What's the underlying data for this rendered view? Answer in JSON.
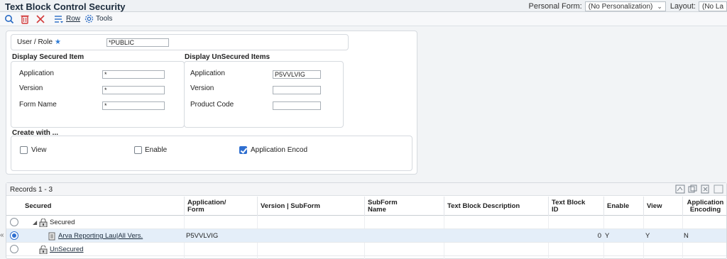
{
  "header": {
    "title": "Text Block Control Security",
    "personal_form_label": "Personal Form:",
    "personal_form_value": "(No Personalization)",
    "layout_label": "Layout:",
    "layout_value": "(No La"
  },
  "toolbar": {
    "row_label": "Row",
    "tools_label": "Tools",
    "icons": [
      "search-icon",
      "delete-icon",
      "close-icon",
      "row-icon",
      "gear-icon"
    ]
  },
  "form": {
    "user_role_label": "User / Role",
    "user_role_value": "*PUBLIC",
    "secured": {
      "title": "Display Secured Item",
      "application_label": "Application",
      "application_value": "*",
      "version_label": "Version",
      "version_value": "*",
      "form_name_label": "Form Name",
      "form_name_value": "*"
    },
    "unsecured": {
      "title": "Display UnSecured Items",
      "application_label": "Application",
      "application_value": "P5VVLVIG",
      "version_label": "Version",
      "version_value": "",
      "product_code_label": "Product Code",
      "product_code_value": ""
    },
    "create_with": {
      "title": "Create with ...",
      "view_label": "View",
      "view_checked": false,
      "enable_label": "Enable",
      "enable_checked": false,
      "app_encoding_label": "Application Encod",
      "app_encoding_checked": true
    }
  },
  "grid": {
    "records_label": "Records 1 - 3",
    "columns": [
      "Secured",
      "Application/\nForm",
      "Version | SubForm",
      "SubForm\nName",
      "Text Block Description",
      "Text Block ID",
      "Enable",
      "View",
      "Application\nEncoding"
    ],
    "rows": [
      {
        "secured": "Secured",
        "application": "",
        "version": "",
        "subform": "",
        "description": "",
        "id": "",
        "enable": "",
        "view": "",
        "encoding": ""
      },
      {
        "secured": "Arva Reporting Lau|All Vers.",
        "application": "P5VVLVIG",
        "version": "",
        "subform": "",
        "description": "",
        "id": "0",
        "enable": "Y",
        "view": "Y",
        "encoding": "N"
      },
      {
        "secured": "UnSecured",
        "application": "",
        "version": "",
        "subform": "",
        "description": "",
        "id": "",
        "enable": "",
        "view": "",
        "encoding": ""
      }
    ]
  }
}
